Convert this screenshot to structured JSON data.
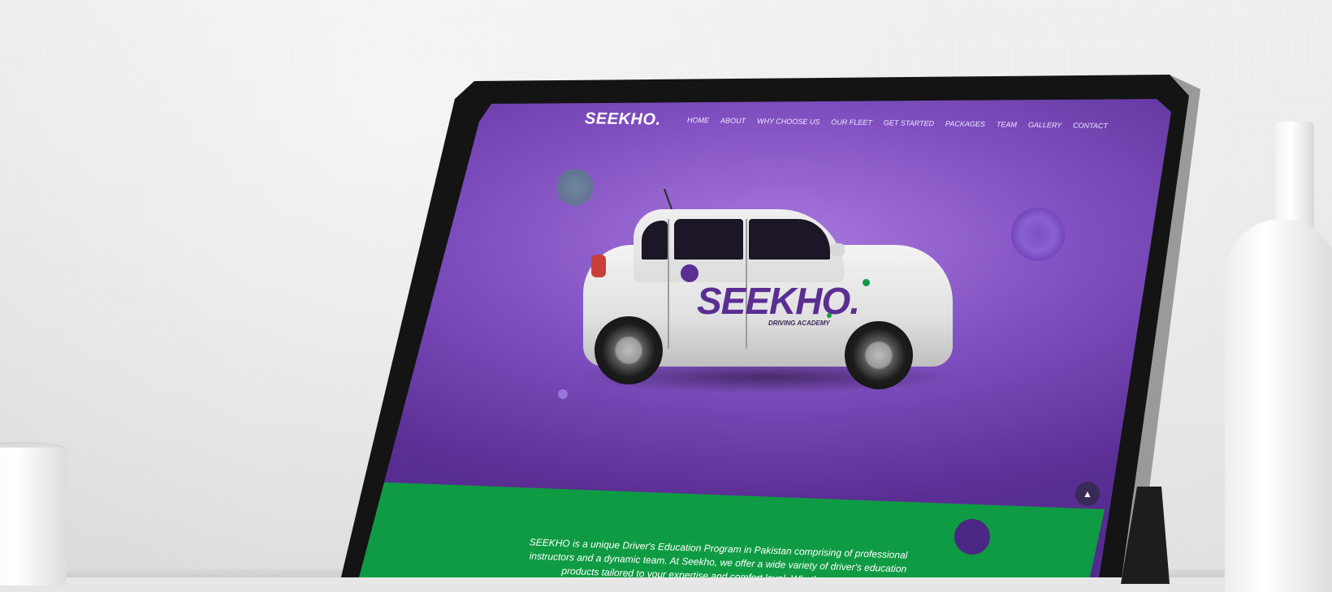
{
  "site": {
    "logo": "SEEKHO.",
    "nav": [
      {
        "label": "HOME"
      },
      {
        "label": "ABOUT"
      },
      {
        "label": "WHY CHOOSE US"
      },
      {
        "label": "OUR FLEET"
      },
      {
        "label": "GET STARTED"
      },
      {
        "label": "PACKAGES"
      },
      {
        "label": "TEAM"
      },
      {
        "label": "GALLERY"
      },
      {
        "label": "CONTACT"
      }
    ],
    "car": {
      "brand": "SEEKHO.",
      "tagline": "DRIVING ACADEMY"
    },
    "scroll_top_icon": "triangle-up-icon",
    "about_text": "SEEKHO is a unique Driver's Education Program in Pakistan comprising of professional instructors and a dynamic team. At Seekho, we offer a wide variety of driver's education products tailored to your expertise and comfort level. Whether you are ..."
  },
  "colors": {
    "hero_purple": "#5a2e93",
    "hero_glow": "#a978dd",
    "green": "#0f9b43",
    "white": "#ffffff"
  }
}
